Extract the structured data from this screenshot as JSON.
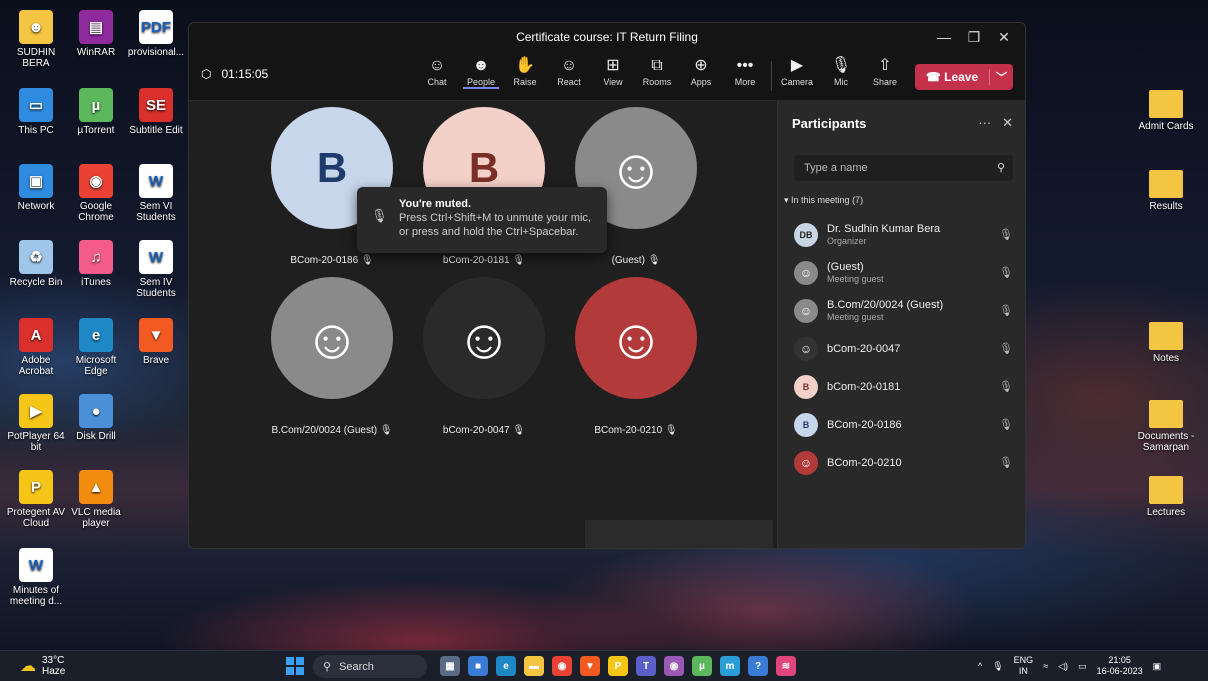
{
  "desktop": {
    "left_icons": [
      {
        "label": "SUDHIN BERA",
        "icon": "user-folder-icon",
        "color": "#f4c542",
        "glyph": "☻"
      },
      {
        "label": "WinRAR",
        "icon": "winrar-icon",
        "color": "#8e2a9c",
        "glyph": "▤"
      },
      {
        "label": "provisional...",
        "icon": "pdf-icon",
        "color": "#ffffff",
        "glyph": "PDF"
      },
      {
        "label": "This PC",
        "icon": "computer-icon",
        "color": "#2f8be0",
        "glyph": "▭"
      },
      {
        "label": "µTorrent",
        "icon": "utorrent-icon",
        "color": "#5cb85c",
        "glyph": "µ"
      },
      {
        "label": "Subtitle Edit",
        "icon": "subtitle-edit-icon",
        "color": "#d9302c",
        "glyph": "SE"
      },
      {
        "label": "Network",
        "icon": "network-icon",
        "color": "#2f8be0",
        "glyph": "▣"
      },
      {
        "label": "Google Chrome",
        "icon": "chrome-icon",
        "color": "#e94235",
        "glyph": "◉"
      },
      {
        "label": "Sem VI Students",
        "icon": "word-doc-icon",
        "color": "#ffffff",
        "glyph": "W"
      },
      {
        "label": "Recycle Bin",
        "icon": "recycle-bin-icon",
        "color": "#9fc6e8",
        "glyph": "♻"
      },
      {
        "label": "iTunes",
        "icon": "itunes-icon",
        "color": "#f25b8b",
        "glyph": "♫"
      },
      {
        "label": "Sem IV Students",
        "icon": "word-doc-icon",
        "color": "#ffffff",
        "glyph": "W"
      },
      {
        "label": "Adobe Acrobat",
        "icon": "acrobat-icon",
        "color": "#d9302c",
        "glyph": "A"
      },
      {
        "label": "Microsoft Edge",
        "icon": "edge-icon",
        "color": "#1e88c7",
        "glyph": "e"
      },
      {
        "label": "Brave",
        "icon": "brave-icon",
        "color": "#f25a22",
        "glyph": "▼"
      },
      {
        "label": "PotPlayer 64 bit",
        "icon": "potplayer-icon",
        "color": "#f5c518",
        "glyph": "▶"
      },
      {
        "label": "Disk Drill",
        "icon": "disk-drill-icon",
        "color": "#4a90d9",
        "glyph": "●"
      },
      {
        "label": "Protegent AV Cloud",
        "icon": "protegent-icon",
        "color": "#f5c518",
        "glyph": "P"
      },
      {
        "label": "VLC media player",
        "icon": "vlc-icon",
        "color": "#f28c0f",
        "glyph": "▲"
      },
      {
        "label": "Minutes of meeting d...",
        "icon": "word-doc-icon",
        "color": "#ffffff",
        "glyph": "W"
      }
    ],
    "right_icons": [
      {
        "label": "Admit Cards",
        "icon": "folder-icon"
      },
      {
        "label": "Results",
        "icon": "folder-icon"
      },
      {
        "label": "Notes",
        "icon": "folder-icon"
      },
      {
        "label": "Documents - Samarpan",
        "icon": "folder-icon"
      },
      {
        "label": "Lectures",
        "icon": "folder-icon"
      }
    ]
  },
  "teams": {
    "title": "Certificate course: IT Return Filing",
    "timer": "01:15:05",
    "toolbar": [
      {
        "label": "Chat",
        "glyph": "☺",
        "icon": "chat-icon"
      },
      {
        "label": "People",
        "glyph": "☻",
        "icon": "people-icon",
        "active": true
      },
      {
        "label": "Raise",
        "glyph": "✋",
        "icon": "raise-hand-icon"
      },
      {
        "label": "React",
        "glyph": "☺",
        "icon": "react-icon"
      },
      {
        "label": "View",
        "glyph": "⊞",
        "icon": "view-icon"
      },
      {
        "label": "Rooms",
        "glyph": "⧉",
        "icon": "rooms-icon"
      },
      {
        "label": "Apps",
        "glyph": "⊕",
        "icon": "apps-icon"
      },
      {
        "label": "More",
        "glyph": "•••",
        "icon": "more-icon"
      }
    ],
    "media": [
      {
        "label": "Camera",
        "glyph": "▶",
        "icon": "camera-off-icon"
      },
      {
        "label": "Mic",
        "glyph": "🎙",
        "icon": "mic-off-icon"
      },
      {
        "label": "Share",
        "glyph": "⇧",
        "icon": "share-icon"
      }
    ],
    "leave_label": "Leave",
    "tiles": [
      {
        "name": "BCom-20-0186",
        "initial": "B",
        "bg": "#c8d6ec",
        "fg": "#1f3b6b"
      },
      {
        "name": "bCom-20-0181",
        "initial": "B",
        "bg": "#f3d1c9",
        "fg": "#7a2e25"
      },
      {
        "name": "(Guest)",
        "initial": "",
        "bg": "#8a8a8a",
        "fg": "#ffffff"
      },
      {
        "name": "B.Com/20/0024 (Guest)",
        "initial": "",
        "bg": "#8a8a8a",
        "fg": "#ffffff"
      },
      {
        "name": "bCom-20-0047",
        "initial": "",
        "bg": "#2a2a2a",
        "fg": "#ffffff"
      },
      {
        "name": "BCom-20-0210",
        "initial": "",
        "bg": "#b33a3a",
        "fg": "#ffffff"
      }
    ],
    "toast": {
      "title": "You're muted.",
      "body": "Press Ctrl+Shift+M to unmute your mic, or press and hold the Ctrl+Spacebar."
    },
    "self_initials": "DB",
    "participants": {
      "title": "Participants",
      "search_placeholder": "Type a name",
      "section": "In this meeting (7)",
      "list": [
        {
          "name": "Dr. Sudhin Kumar Bera",
          "role": "Organizer",
          "initials": "DB",
          "bg": "#c8d6e3",
          "fg": "#222"
        },
        {
          "name": "(Guest)",
          "role": "Meeting guest",
          "initials": "",
          "bg": "#8a8a8a",
          "fg": "#fff"
        },
        {
          "name": "B.Com/20/0024 (Guest)",
          "role": "Meeting guest",
          "initials": "",
          "bg": "#8a8a8a",
          "fg": "#fff"
        },
        {
          "name": "bCom-20-0047",
          "role": "",
          "initials": "",
          "bg": "#333",
          "fg": "#fff"
        },
        {
          "name": "bCom-20-0181",
          "role": "",
          "initials": "B",
          "bg": "#f3d1c9",
          "fg": "#7a2e25"
        },
        {
          "name": "BCom-20-0186",
          "role": "",
          "initials": "B",
          "bg": "#c8d6ec",
          "fg": "#1f3b6b"
        },
        {
          "name": "BCom-20-0210",
          "role": "",
          "initials": "",
          "bg": "#b33a3a",
          "fg": "#fff"
        }
      ]
    }
  },
  "taskbar": {
    "temp": "33°C",
    "weather": "Haze",
    "search": "Search",
    "apps": [
      {
        "icon": "task-view-icon",
        "color": "#5a6b85",
        "glyph": "▦"
      },
      {
        "icon": "store-icon",
        "color": "#3a7bd5",
        "glyph": "■"
      },
      {
        "icon": "edge-icon",
        "color": "#1e88c7",
        "glyph": "e"
      },
      {
        "icon": "file-explorer-icon",
        "color": "#f4c542",
        "glyph": "▬"
      },
      {
        "icon": "chrome-icon",
        "color": "#e94235",
        "glyph": "◉"
      },
      {
        "icon": "brave-icon",
        "color": "#f25a22",
        "glyph": "▼"
      },
      {
        "icon": "protegent-icon",
        "color": "#f5c518",
        "glyph": "P"
      },
      {
        "icon": "teams-icon",
        "color": "#5b5fc7",
        "glyph": "T"
      },
      {
        "icon": "chrome-profile-icon",
        "color": "#9b59b6",
        "glyph": "◉"
      },
      {
        "icon": "utorrent-icon",
        "color": "#5cb85c",
        "glyph": "µ"
      },
      {
        "icon": "mydp-icon",
        "color": "#2a9fd6",
        "glyph": "m"
      },
      {
        "icon": "help-icon",
        "color": "#3a7bd5",
        "glyph": "?"
      },
      {
        "icon": "spotify-icon",
        "color": "#e0457b",
        "glyph": "≋"
      }
    ],
    "lang": "ENG",
    "region": "IN",
    "time": "21:05",
    "date": "16-06-2023"
  }
}
